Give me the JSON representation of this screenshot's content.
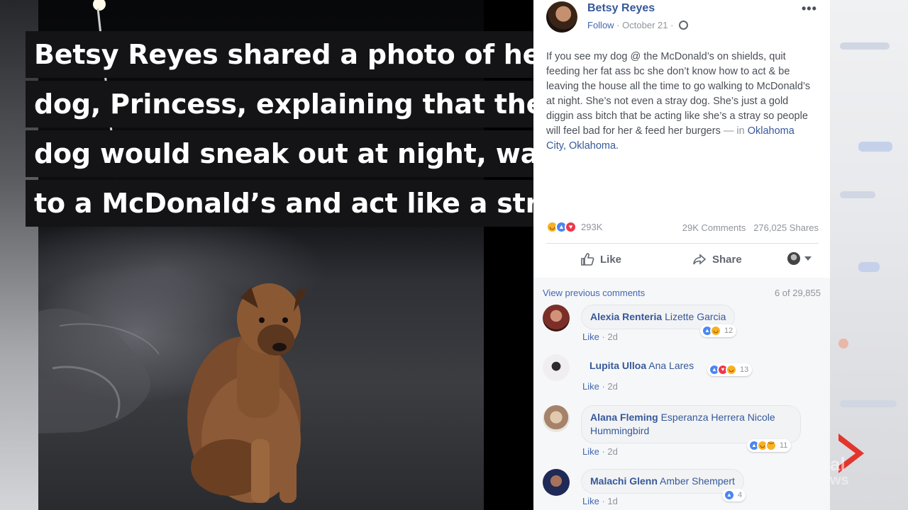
{
  "caption": {
    "lines": [
      "Betsy Reyes shared a photo of her",
      "dog, Princess, explaining that the",
      "dog would sneak out at night, walk",
      "to a McDonald’s and act like a stray."
    ]
  },
  "post": {
    "author": "Betsy Reyes",
    "follow_label": "Follow",
    "date": "October 21",
    "text": "If you see my dog @ the McDonald’s on shields, quit feeding her fat ass bc she don’t know how to act & be leaving the house all the time to go walking to McDonald’s at night. She’s not even a stray dog. She’s just a gold diggin ass bitch that be acting like she’s a stray so people will feel bad for her & feed her burgers",
    "location_prefix": " — in ",
    "location": "Oklahoma City, Oklahoma.",
    "reaction_count": "293K",
    "comments_count": "29K Comments",
    "shares_count": "276,025 Shares",
    "like_label": "Like",
    "share_label": "Share",
    "reaction_icons": [
      "haha",
      "like",
      "love"
    ]
  },
  "comments_header": {
    "view_previous": "View previous comments",
    "page_count": "6 of 29,855"
  },
  "comments": [
    {
      "name": "Alexia Renteria",
      "text": "Lizette Garcia",
      "like": "Like",
      "time": "2d",
      "reaction_count": "12",
      "reactions": [
        "like",
        "haha"
      ],
      "avatar_color": "#b8554b"
    },
    {
      "name": "Lupita Ulloa",
      "text": "Ana Lares",
      "like": "Like",
      "time": "2d",
      "reaction_count": "13",
      "reactions": [
        "like",
        "love",
        "haha"
      ],
      "avatar_color": "#d9cfd2"
    },
    {
      "name": "Alana Fleming",
      "text": "Esperanza Herrera Nicole Hummingbird",
      "like": "Like",
      "time": "2d",
      "reaction_count": "11",
      "reactions": [
        "like",
        "haha",
        "sad"
      ],
      "avatar_color": "#cdb69c"
    },
    {
      "name": "Malachi Glenn",
      "text": "Amber Shempert",
      "like": "Like",
      "time": "1d",
      "reaction_count": "4",
      "reactions": [
        "like"
      ],
      "avatar_color": "#1f2a57"
    }
  ],
  "watermark": {
    "text": "al\nws"
  },
  "colors": {
    "caption_bg": "#141416",
    "fb_link": "#365899",
    "fb_muted": "#90949c",
    "logo_red": "#e2231a"
  }
}
